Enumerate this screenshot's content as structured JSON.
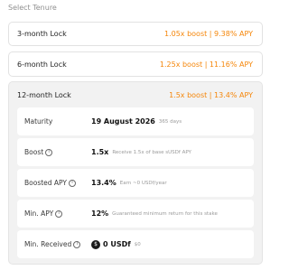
{
  "section_label": "Select Tenure",
  "tenures": [
    {
      "name": "3-month Lock",
      "boost": "1.05x boost | 9.38% APY"
    },
    {
      "name": "6-month Lock",
      "boost": "1.25x boost | 11.16% APY"
    },
    {
      "name": "12-month Lock",
      "boost": "1.5x boost | 13.4% APY"
    }
  ],
  "details": {
    "maturity": {
      "label": "Maturity",
      "value": "19 August 2026",
      "note": "365 days"
    },
    "boost": {
      "label": "Boost",
      "value": "1.5x",
      "note": "Receive 1.5x of base sUSDf APY"
    },
    "boosted_apy": {
      "label": "Boosted APY",
      "value": "13.4%",
      "note": "Earn ~0 USDf/year"
    },
    "min_apy": {
      "label": "Min. APY",
      "value": "12%",
      "note": "Guaranteed minimum return for this stake"
    },
    "min_received": {
      "label": "Min. Received",
      "value": "0 USDf",
      "note": "$0"
    }
  },
  "colors": {
    "accent": "#f5860a",
    "selected_bg": "#f2f2f2"
  },
  "icons": {
    "info": "info-circle-icon",
    "coin": "usdf-coin-icon"
  }
}
